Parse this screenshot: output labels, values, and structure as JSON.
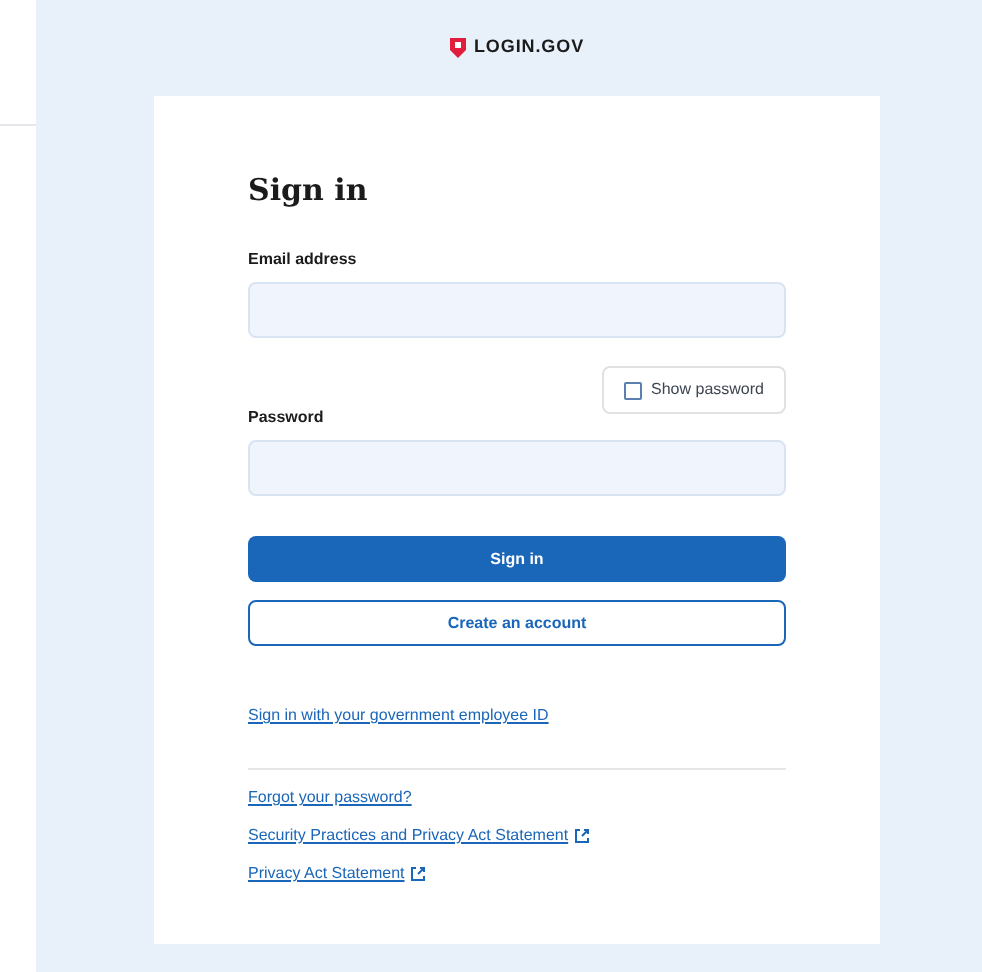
{
  "brand": {
    "name": "LOGIN.GOV"
  },
  "heading": "Sign in",
  "email": {
    "label": "Email address"
  },
  "show_password": {
    "label": "Show password",
    "checked": false
  },
  "password": {
    "label": "Password"
  },
  "buttons": {
    "primary": "Sign in",
    "secondary": "Create an account"
  },
  "piv_link": "Sign in with your government employee ID",
  "links": [
    {
      "label": "Forgot your password?",
      "external": false
    },
    {
      "label": "Security Practices and Privacy Act Statement",
      "external": true
    },
    {
      "label": "Privacy Act Statement",
      "external": true
    }
  ]
}
